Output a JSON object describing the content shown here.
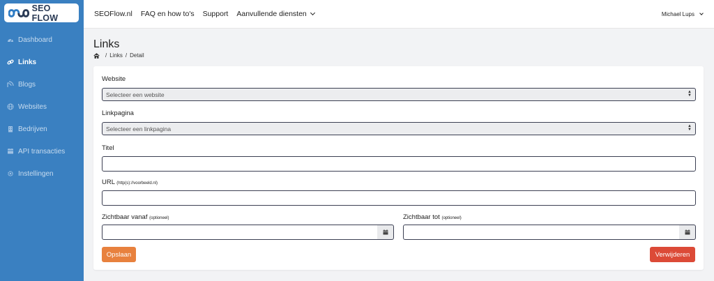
{
  "brand": {
    "name": "SEO FLOW"
  },
  "sidebar": {
    "items": [
      {
        "label": "Dashboard",
        "icon": "dashboard-icon"
      },
      {
        "label": "Links",
        "icon": "link-icon",
        "active": true
      },
      {
        "label": "Blogs",
        "icon": "blog-icon"
      },
      {
        "label": "Websites",
        "icon": "globe-icon"
      },
      {
        "label": "Bedrijven",
        "icon": "building-icon"
      },
      {
        "label": "API transacties",
        "icon": "transactions-icon"
      },
      {
        "label": "Instellingen",
        "icon": "gear-icon"
      }
    ]
  },
  "topnav": {
    "items": [
      "SEOFlow.nl",
      "FAQ en how to's",
      "Support",
      "Aanvullende diensten"
    ],
    "user": "Michael Lups"
  },
  "page": {
    "title": "Links",
    "breadcrumb": [
      "Links",
      "Detail"
    ]
  },
  "form": {
    "website_label": "Website",
    "website_placeholder": "Selecteer een website",
    "linkpagina_label": "Linkpagina",
    "linkpagina_placeholder": "Selecteer een linkpagina",
    "titel_label": "Titel",
    "titel_value": "",
    "url_label": "URL",
    "url_hint": "(http(s)://voorbeeld.nl)",
    "url_value": "",
    "vanaf_label": "Zichtbaar vanaf",
    "vanaf_hint": "(optioneel)",
    "tot_label": "Zichtbaar tot",
    "tot_hint": "(optioneel)",
    "save_label": "Opslaan",
    "delete_label": "Verwijderen"
  },
  "colors": {
    "sidebar": "#3a80c1",
    "save_button": "#e8813e",
    "delete_button": "#dc4a37"
  }
}
